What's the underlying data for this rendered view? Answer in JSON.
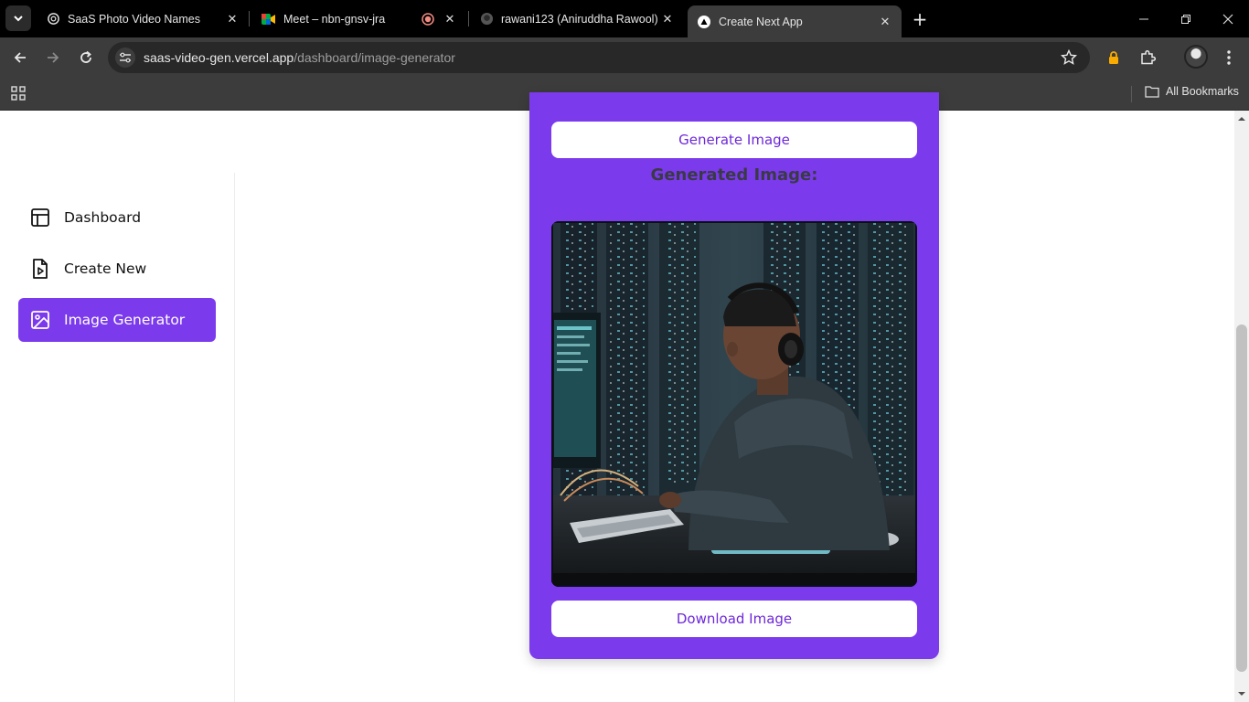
{
  "browser": {
    "tabs": [
      {
        "title": "SaaS Photo Video Names",
        "icon": "openai-icon"
      },
      {
        "title": "Meet – nbn-gnsv-jra",
        "icon": "google-meet-icon",
        "recording": true
      },
      {
        "title": "rawani123 (Aniruddha Rawool)",
        "icon": "github-icon"
      },
      {
        "title": "Create Next App",
        "icon": "vercel-icon",
        "active": true
      }
    ],
    "url": {
      "host": "saas-video-gen.vercel.app",
      "path": "/dashboard/image-generator"
    },
    "bookmarks": {
      "all_label": "All Bookmarks"
    }
  },
  "sidebar": {
    "items": [
      {
        "label": "Dashboard",
        "icon": "layout-icon"
      },
      {
        "label": "Create New",
        "icon": "file-video-icon"
      },
      {
        "label": "Image Generator",
        "icon": "image-icon",
        "active": true
      }
    ]
  },
  "generator": {
    "generate_label": "Generate Image",
    "heading": "Generated Image:",
    "download_label": "Download Image"
  },
  "colors": {
    "accent": "#7c3aed",
    "button_text": "#6d28d9",
    "browser_dark": "#3c3c3c"
  }
}
